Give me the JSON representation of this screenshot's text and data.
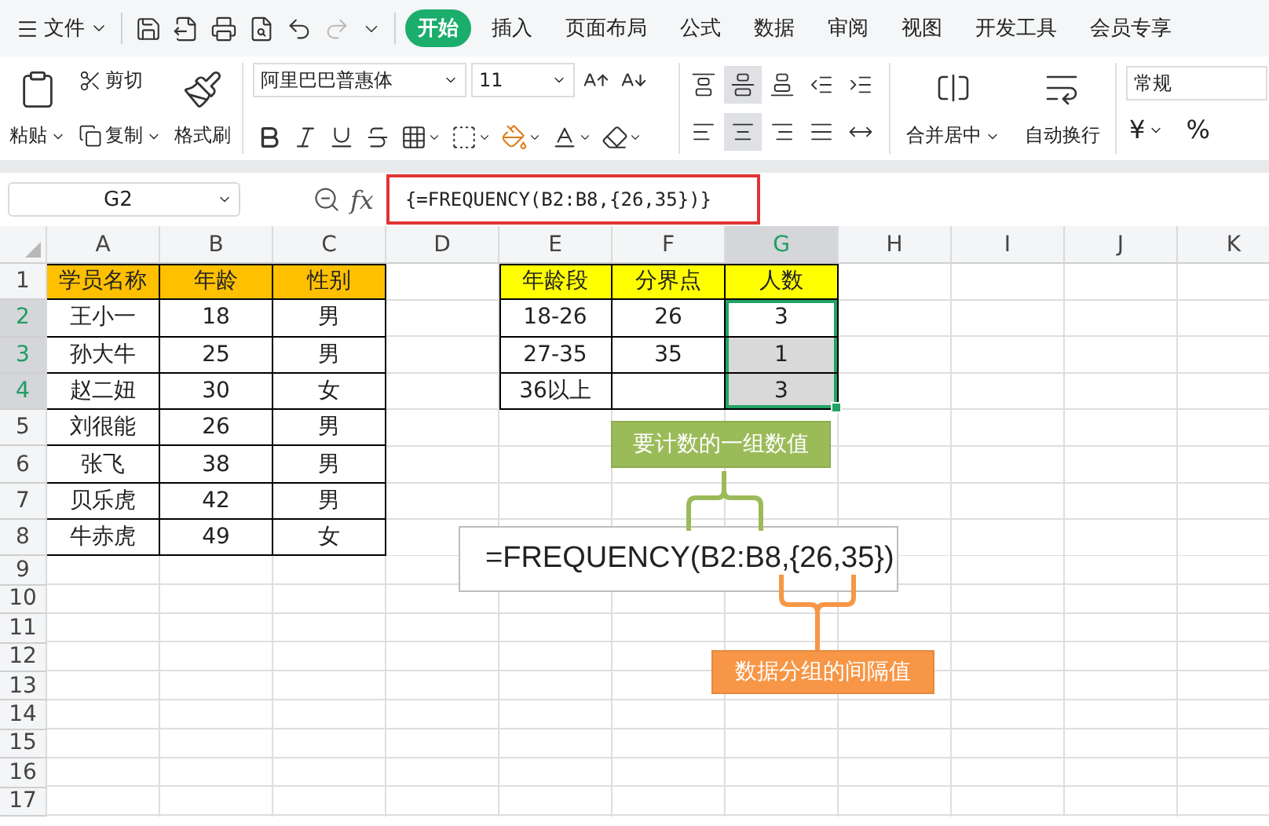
{
  "menu_bar": {
    "file_menu": "文件",
    "tabs": [
      {
        "label": "开始",
        "selected": true
      },
      {
        "label": "插入",
        "selected": false
      },
      {
        "label": "页面布局",
        "selected": false
      },
      {
        "label": "公式",
        "selected": false
      },
      {
        "label": "数据",
        "selected": false
      },
      {
        "label": "审阅",
        "selected": false
      },
      {
        "label": "视图",
        "selected": false
      },
      {
        "label": "开发工具",
        "selected": false
      },
      {
        "label": "会员专享",
        "selected": false
      }
    ]
  },
  "ribbon": {
    "paste": "粘贴",
    "cut": "剪切",
    "copy": "复制",
    "format_painter": "格式刷",
    "font_name": "阿里巴巴普惠体",
    "font_size": "11",
    "alignment": [
      {
        "kind": "top",
        "selected": false
      },
      {
        "kind": "middle",
        "selected": true
      },
      {
        "kind": "bottom",
        "selected": false
      },
      {
        "kind": "outdent",
        "selected": false
      },
      {
        "kind": "indent",
        "selected": false
      },
      {
        "kind": "left",
        "selected": false
      },
      {
        "kind": "center",
        "selected": true
      },
      {
        "kind": "right",
        "selected": false
      },
      {
        "kind": "justify",
        "selected": false
      },
      {
        "kind": "distribute",
        "selected": false
      }
    ],
    "merge": "合并居中",
    "wrap": "自动换行",
    "number_format": "常规",
    "currency": "¥",
    "percent": "%"
  },
  "formula_bar": {
    "name_box": "G2",
    "fx": "fx",
    "formula": "{=FREQUENCY(B2:B8,{26,35})}"
  },
  "sheet": {
    "columns": [
      {
        "label": "A",
        "selected": false
      },
      {
        "label": "B",
        "selected": false
      },
      {
        "label": "C",
        "selected": false
      },
      {
        "label": "D",
        "selected": false
      },
      {
        "label": "E",
        "selected": false
      },
      {
        "label": "F",
        "selected": false
      },
      {
        "label": "G",
        "selected": true
      },
      {
        "label": "H",
        "selected": false
      },
      {
        "label": "I",
        "selected": false
      },
      {
        "label": "J",
        "selected": false
      },
      {
        "label": "K",
        "selected": false
      }
    ],
    "row_numbers": [
      {
        "label": "1",
        "selected": false
      },
      {
        "label": "2",
        "selected": true
      },
      {
        "label": "3",
        "selected": true
      },
      {
        "label": "4",
        "selected": true
      },
      {
        "label": "5",
        "selected": false
      },
      {
        "label": "6",
        "selected": false
      },
      {
        "label": "7",
        "selected": false
      },
      {
        "label": "8",
        "selected": false
      },
      {
        "label": "9",
        "selected": false
      },
      {
        "label": "10",
        "selected": false
      },
      {
        "label": "11",
        "selected": false
      },
      {
        "label": "12",
        "selected": false
      },
      {
        "label": "13",
        "selected": false
      },
      {
        "label": "14",
        "selected": false
      },
      {
        "label": "15",
        "selected": false
      },
      {
        "label": "16",
        "selected": false
      },
      {
        "label": "17",
        "selected": false
      }
    ],
    "student_table": {
      "header": [
        "学员名称",
        "年龄",
        "性别"
      ],
      "rows": [
        [
          "王小一",
          "18",
          "男"
        ],
        [
          "孙大牛",
          "25",
          "男"
        ],
        [
          "赵二妞",
          "30",
          "女"
        ],
        [
          "刘很能",
          "26",
          "男"
        ],
        [
          "张飞",
          "38",
          "男"
        ],
        [
          "贝乐虎",
          "42",
          "男"
        ],
        [
          "牛赤虎",
          "49",
          "女"
        ]
      ]
    },
    "frequency_table": {
      "header": [
        "年龄段",
        "分界点",
        "人数"
      ],
      "rows": [
        {
          "cells": [
            "18-26",
            "26",
            "3"
          ],
          "selected": true,
          "active": true
        },
        {
          "cells": [
            "27-35",
            "35",
            "1"
          ],
          "selected": true,
          "active": false
        },
        {
          "cells": [
            "36以上",
            null,
            "3"
          ],
          "selected": true,
          "active": false
        }
      ]
    }
  },
  "annotation": {
    "top_label": "要计数的一组数值",
    "formula": "=FREQUENCY(B2:B8,{26,35})",
    "bottom_label": "数据分组的间隔值"
  }
}
